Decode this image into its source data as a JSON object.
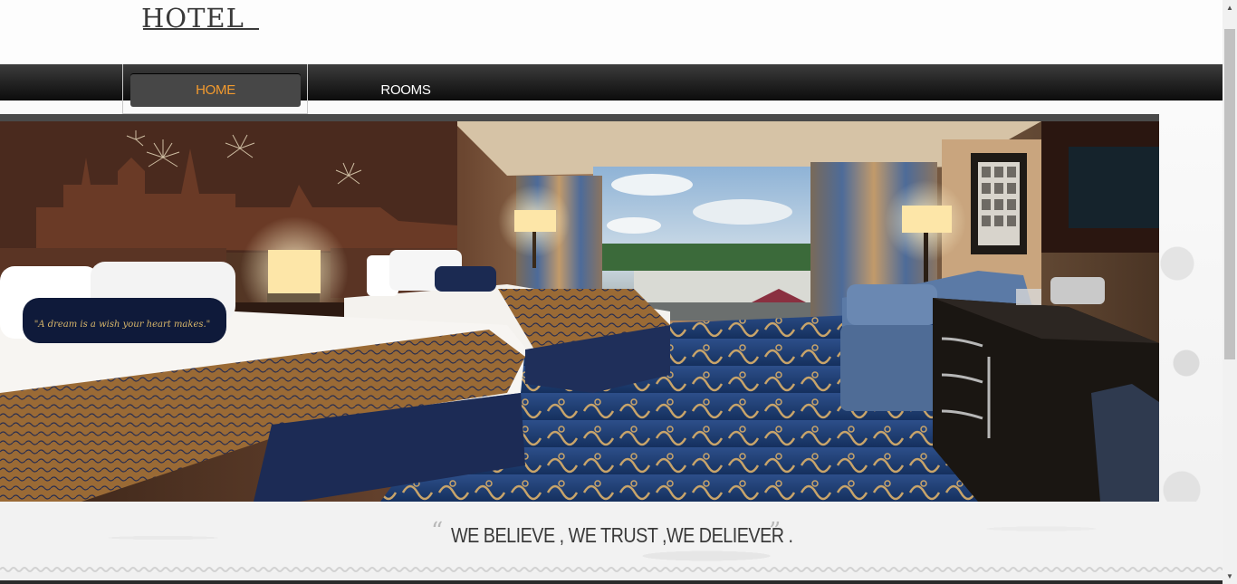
{
  "header": {
    "logo_text": "HOTEL"
  },
  "nav": {
    "items": [
      {
        "label": "HOME",
        "active": true
      },
      {
        "label": "ROOMS",
        "active": false
      }
    ],
    "active_color": "#f29a2e"
  },
  "hero": {
    "pillow_text": "\"A dream is a wish your heart makes.\""
  },
  "tagline": {
    "open_quote": "“",
    "text": "WE BELIEVE , WE TRUST ,WE DELIEVER .",
    "close_quote": "”"
  },
  "scrollbar": {
    "up_icon": "▲",
    "down_icon": "▼"
  }
}
